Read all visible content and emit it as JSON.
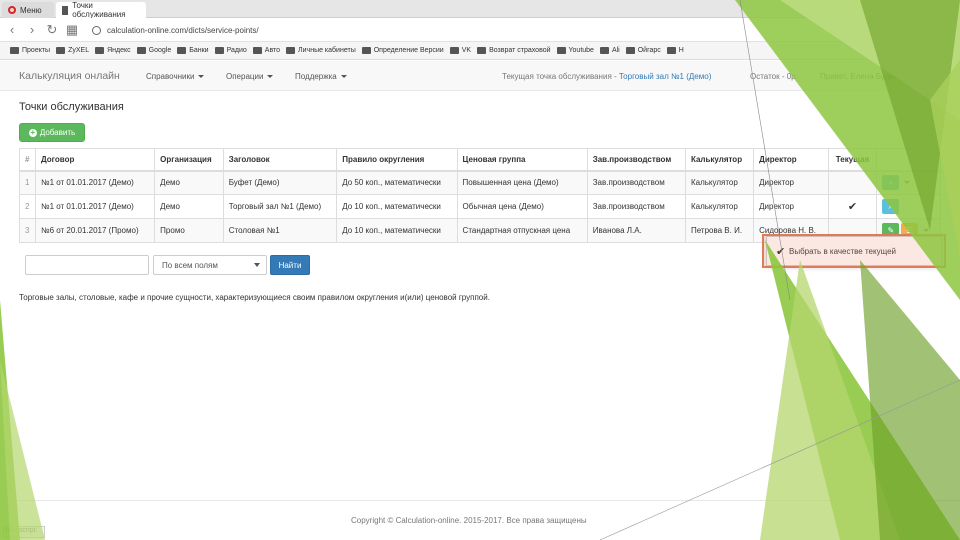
{
  "browser": {
    "tabs": [
      "Меню",
      "Точки обслуживания"
    ],
    "url": "calculation-online.com/dicts/service-points/",
    "bookmarks": [
      "Проекты",
      "ZyXEL",
      "Яндекс",
      "Google",
      "Банки",
      "Радио",
      "Авто",
      "Личные кабинеты",
      "Определение Версии",
      "VK",
      "Возврат страховой",
      "Youtube",
      "Ali",
      "Ойгарс",
      "Н"
    ]
  },
  "navbar": {
    "brand": "Калькуляция онлайн",
    "menus": [
      "Справочники",
      "Операции",
      "Поддержка"
    ],
    "current_point_label": "Текущая точка обслуживания -",
    "current_point_value": "Торговый зал №1 (Демо)",
    "balance": "Остаток - 0р.",
    "greeting": "Привет, Елена Будило"
  },
  "page": {
    "title": "Точки обслуживания",
    "add_label": "Добавить"
  },
  "table": {
    "headers": [
      "#",
      "Договор",
      "Организация",
      "Заголовок",
      "Правило округления",
      "Ценовая группа",
      "Зав.производством",
      "Калькулятор",
      "Директор",
      "Текущая",
      ""
    ],
    "rows": [
      {
        "num": "1",
        "contract": "№1 от 01.01.2017 (Демо)",
        "org": "Демо",
        "title": "Буфет (Демо)",
        "rounding": "До 50 коп., математически",
        "price_group": "Повышенная цена (Демо)",
        "production": "Зав.производством",
        "calculator": "Калькулятор",
        "director": "Директор",
        "current": ""
      },
      {
        "num": "2",
        "contract": "№1 от 01.01.2017 (Демо)",
        "org": "Демо",
        "title": "Торговый зал №1 (Демо)",
        "rounding": "До 10 коп., математически",
        "price_group": "Обычная цена (Демо)",
        "production": "Зав.производством",
        "calculator": "Калькулятор",
        "director": "Директор",
        "current": "✔"
      },
      {
        "num": "3",
        "contract": "№6 от 20.01.2017 (Промо)",
        "org": "Промо",
        "title": "Столовая №1",
        "rounding": "До 10 коп., математически",
        "price_group": "Стандартная отпускная цена",
        "production": "Иванова Л.А.",
        "calculator": "Петрова В. И.",
        "director": "Сидорова Н. В.",
        "current": ""
      }
    ]
  },
  "dropdown": {
    "set_current_label": "Выбрать в качестве текущей"
  },
  "search": {
    "select_value": "По всем полям",
    "button_label": "Найти"
  },
  "description": "Торговые залы, столовые, кафе и прочие сущности, характеризующиеся своим правилом округления и(или) ценовой группой.",
  "footer": "Copyright © Calculation-online. 2015-2017. Все права защищены",
  "status_text": "javascript:",
  "colors": {
    "brand_green": "#5cb85c",
    "link_blue": "#337ab7",
    "highlight": "#e07b5a",
    "slide_green": "#8dc63f"
  }
}
